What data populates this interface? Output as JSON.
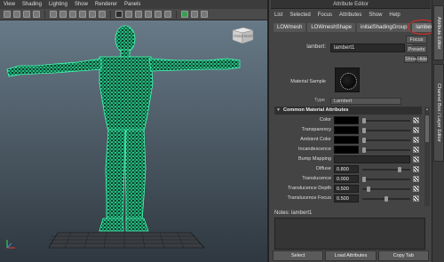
{
  "viewport": {
    "menu": [
      "View",
      "Shading",
      "Lighting",
      "Show",
      "Renderer",
      "Panels"
    ],
    "viewcube_labels": [
      "FRONT",
      "RIGHT"
    ]
  },
  "attribute_editor": {
    "title": "Attribute Editor",
    "menu": [
      "List",
      "Selected",
      "Focus",
      "Attributes",
      "Show",
      "Help"
    ],
    "tabs": [
      {
        "label": "LOWmesh",
        "active": false
      },
      {
        "label": "LOWmeshShape",
        "active": false
      },
      {
        "label": "initialShadingGroup",
        "active": false
      },
      {
        "label": "lambert1",
        "active": true
      }
    ],
    "material_label": "lambert:",
    "material_value": "lambert1",
    "focus_button": "Focus",
    "presets_button": "Presets",
    "show_button": "Show",
    "hide_button": "Hide",
    "sample_label": "Material Sample",
    "type_label": "Type",
    "type_value": "Lambert",
    "section_title": "Common Material Attributes",
    "attributes": [
      {
        "label": "Color",
        "kind": "color"
      },
      {
        "label": "Transparency",
        "kind": "color"
      },
      {
        "label": "Ambient Color",
        "kind": "color"
      },
      {
        "label": "Incandescence",
        "kind": "color"
      },
      {
        "label": "Bump Mapping",
        "kind": "bump"
      },
      {
        "label": "Diffuse",
        "kind": "value",
        "value": "0.800",
        "level": 0.8
      },
      {
        "label": "Translucence",
        "kind": "value",
        "value": "0.000",
        "level": 0.0
      },
      {
        "label": "Translucence Depth",
        "kind": "value",
        "value": "0.500",
        "level": 0.1
      },
      {
        "label": "Translucence Focus",
        "kind": "value",
        "value": "0.500",
        "level": 0.5
      }
    ],
    "notes_label": "Notes: lambert1",
    "bottom_buttons": [
      "Select",
      "Load Attributes",
      "Copy Tab"
    ]
  },
  "side_tabs": [
    "Attribute Editor",
    "Channel Box / Layer Editor"
  ],
  "colors": {
    "wireframe": "#28f0a0",
    "highlight_ring": "#d82b23"
  }
}
